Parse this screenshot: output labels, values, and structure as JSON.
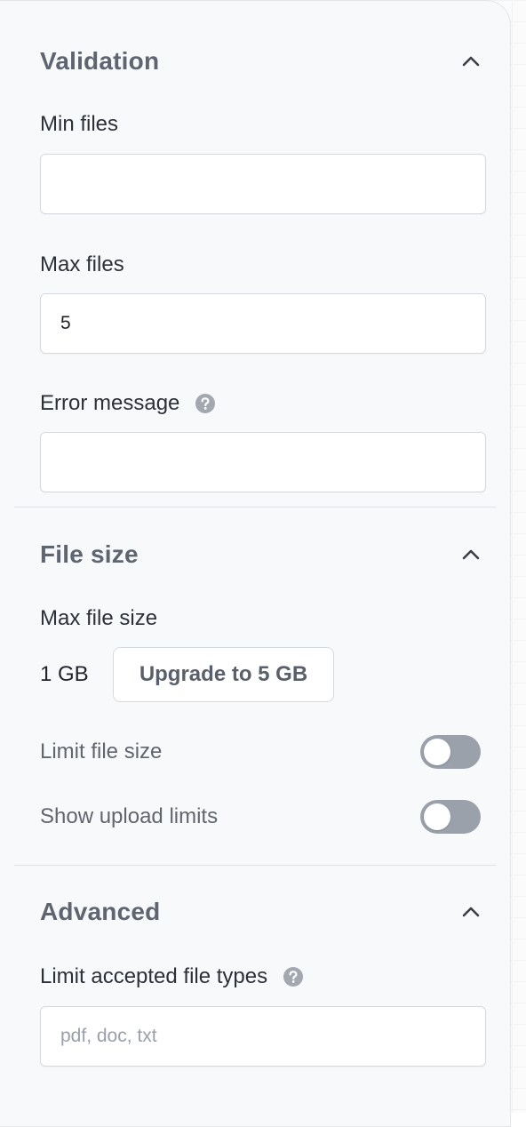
{
  "validation": {
    "title": "Validation",
    "min_files": {
      "label": "Min files",
      "value": "",
      "placeholder": ""
    },
    "max_files": {
      "label": "Max files",
      "value": "5",
      "placeholder": ""
    },
    "error_message": {
      "label": "Error message",
      "value": "",
      "placeholder": ""
    }
  },
  "file_size": {
    "title": "File size",
    "max_file_size_label": "Max file size",
    "max_file_size_value": "1 GB",
    "upgrade_label": "Upgrade to 5 GB",
    "limit_file_size": {
      "label": "Limit file size",
      "on": false
    },
    "show_upload_limits": {
      "label": "Show upload limits",
      "on": false
    }
  },
  "advanced": {
    "title": "Advanced",
    "accepted_types": {
      "label": "Limit accepted file types",
      "value": "",
      "placeholder": "pdf, doc, txt"
    }
  },
  "icons": {
    "collapse": "chevron-up-icon",
    "help": "question-circle-icon"
  },
  "colors": {
    "panel_bg": "#f8f9fb",
    "toggle_off": "#9ba1ab",
    "title": "#5e6470",
    "help_icon": "#a3a8b0"
  }
}
